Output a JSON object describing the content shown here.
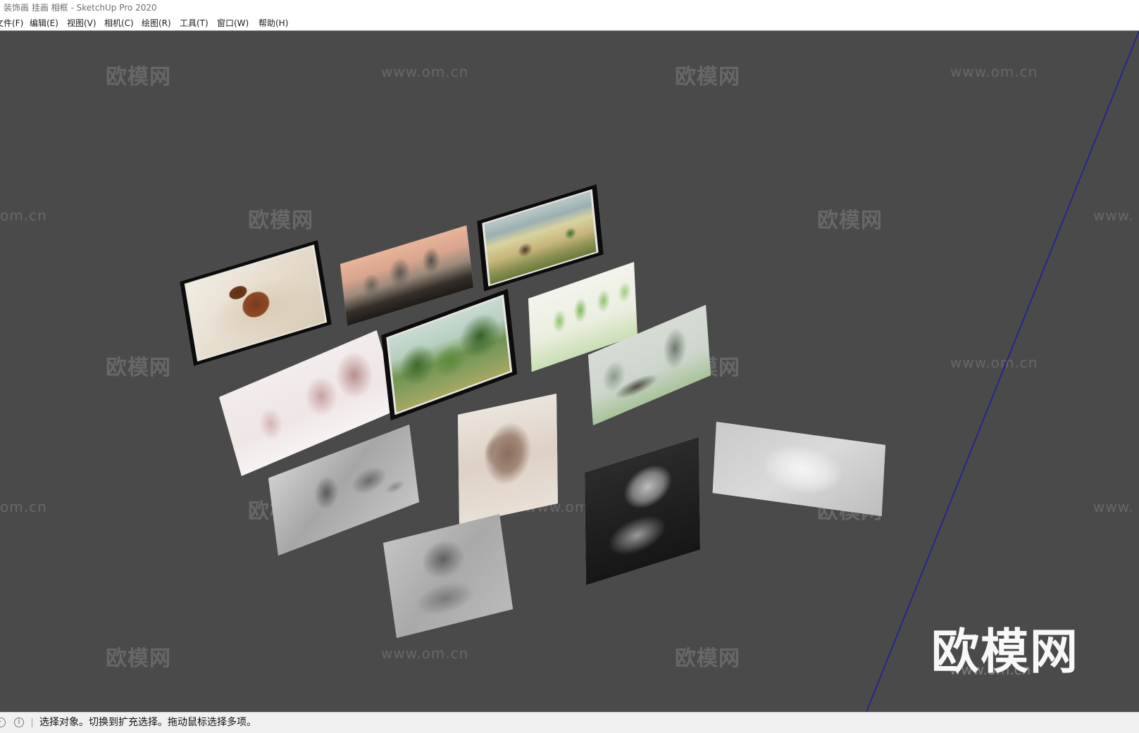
{
  "window": {
    "title": "装饰画 挂画 相框 - SketchUp Pro 2020"
  },
  "menu": {
    "items": [
      {
        "label": "文件(F)"
      },
      {
        "label": "编辑(E)"
      },
      {
        "label": "视图(V)"
      },
      {
        "label": "相机(C)"
      },
      {
        "label": "绘图(R)"
      },
      {
        "label": "工具(T)"
      },
      {
        "label": "窗口(W)"
      },
      {
        "label": "帮助(H)"
      }
    ]
  },
  "watermark": {
    "brand_text": "欧模网",
    "url_text": "www.om.cn",
    "partial_url_left": "om.cn",
    "partial_url_right": "www."
  },
  "scene": {
    "axis_color": "#1a1aa8",
    "background_color": "#4a4a4a",
    "pictures": [
      {
        "id": "horse-painting",
        "subject": "running brown horse, watercolor",
        "framed": true
      },
      {
        "id": "guilin-landscape",
        "subject": "karst mountains at dusk",
        "framed": false
      },
      {
        "id": "old-house-painting",
        "subject": "old stone farmhouse",
        "framed": true
      },
      {
        "id": "spring-trees",
        "subject": "green trees, light watercolor",
        "framed": false
      },
      {
        "id": "street-watercolor",
        "subject": "pink town street, watercolor",
        "framed": false
      },
      {
        "id": "forest-landscape",
        "subject": "green forest landscape",
        "framed": true
      },
      {
        "id": "ink-village",
        "subject": "ink-wash village with willows",
        "framed": false
      },
      {
        "id": "still-life-sketch",
        "subject": "pencil still life: vase, pot, apples",
        "framed": false
      },
      {
        "id": "portrait-sketch",
        "subject": "sepia portrait sketch",
        "framed": false
      },
      {
        "id": "cat-sketch",
        "subject": "white cat pencil drawing",
        "framed": false
      },
      {
        "id": "bust-sketch",
        "subject": "plaster bust pencil drawing",
        "framed": false
      },
      {
        "id": "dark-bust-sketch",
        "subject": "dark charcoal bust drawing",
        "framed": false
      }
    ]
  },
  "status": {
    "message": "选择对象。切换到扩充选择。拖动鼠标选择多项。",
    "info_icon": "info-icon",
    "geo_icon": "geolocation-icon"
  }
}
